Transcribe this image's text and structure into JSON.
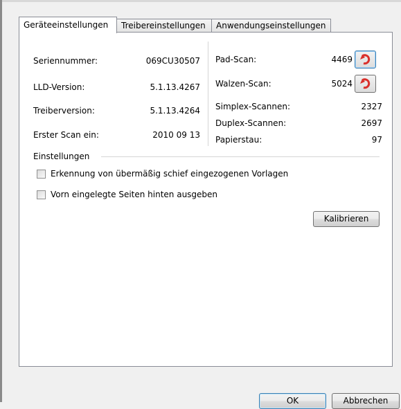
{
  "tabs": [
    {
      "label": "Geräteeinstellungen",
      "active": true
    },
    {
      "label": "Treibereinstellungen",
      "active": false
    },
    {
      "label": "Anwendungseinstellungen",
      "active": false
    }
  ],
  "device_info": {
    "serial_label": "Seriennummer:",
    "serial_value": "069CU30507",
    "lld_label": "LLD-Version:",
    "lld_value": "5.1.13.4267",
    "driver_label": "Treiberversion:",
    "driver_value": "5.1.13.4264",
    "first_scan_label": "Erster Scan ein:",
    "first_scan_value": "2010 09 13"
  },
  "counters": {
    "pad_label": "Pad-Scan:",
    "pad_value": "4469",
    "roller_label": "Walzen-Scan:",
    "roller_value": "5024",
    "simplex_label": "Simplex-Scannen:",
    "simplex_value": "2327",
    "duplex_label": "Duplex-Scannen:",
    "duplex_value": "2697",
    "jam_label": "Papierstau:",
    "jam_value": "97"
  },
  "settings": {
    "group_label": "Einstellungen",
    "skew_label": "Erkennung von übermäßig schief eingezogenen Vorlagen",
    "skew_checked": false,
    "reverse_label": "Vorn eingelegte Seiten hinten ausgeben",
    "reverse_checked": false,
    "calibrate_label": "Kalibrieren"
  },
  "footer": {
    "ok_label": "OK",
    "cancel_label": "Abbrechen"
  },
  "icons": {
    "reset": "reset-counter-icon",
    "reset_color": "#d9302c"
  }
}
